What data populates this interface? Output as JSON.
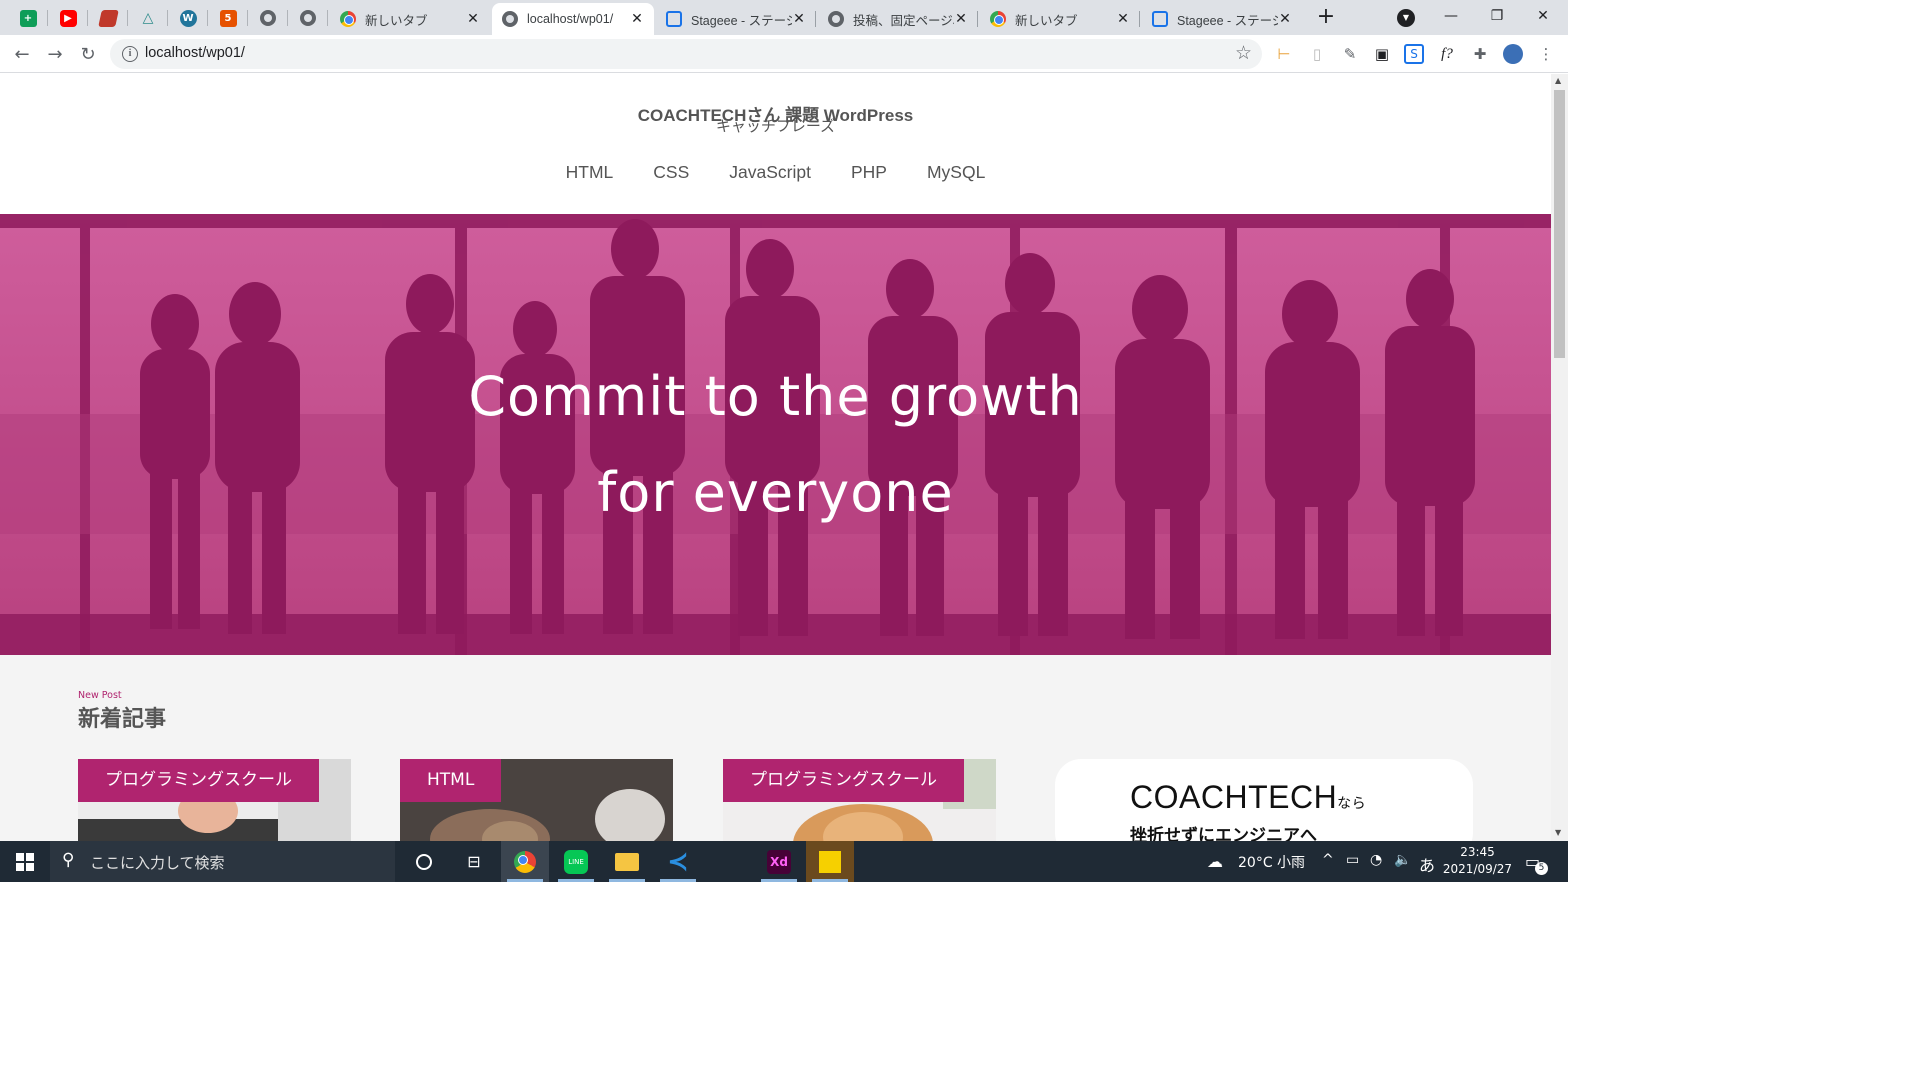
{
  "browser": {
    "tabs": [
      {
        "title": "新しいタブ",
        "active": false
      },
      {
        "title": "localhost/wp01/",
        "active": true
      },
      {
        "title": "Stageee - ステージー",
        "active": false
      },
      {
        "title": "投稿、固定ページ、カ",
        "active": false
      },
      {
        "title": "新しいタブ",
        "active": false
      },
      {
        "title": "Stageee - ステージー",
        "active": false
      }
    ],
    "new_tab_symbol": "+",
    "close_symbol": "✕",
    "address_bar": {
      "url": "localhost/wp01/"
    }
  },
  "site": {
    "title": "COACHTECHさん 課題 WordPress",
    "tagline": "キャッチフレーズ",
    "nav": [
      "HTML",
      "CSS",
      "JavaScript",
      "PHP",
      "MySQL"
    ],
    "hero": {
      "line1": "Commit to the growth",
      "line2": "for everyone"
    },
    "section": {
      "subtitle": "New Post",
      "title": "新着記事"
    },
    "cards": [
      {
        "category": "プログラミングスクール"
      },
      {
        "category": "HTML"
      },
      {
        "category": "プログラミングスクール"
      }
    ],
    "banner": {
      "logo": "COACHTECH",
      "suffix": "なら",
      "subtitle": "挫折せずにエンジニアへ"
    }
  },
  "taskbar": {
    "search_placeholder": "ここに入力して検索",
    "weather": "20°C 小雨",
    "ime": "あ",
    "time": "23:45",
    "date": "2021/09/27",
    "notifications": "5"
  },
  "colors": {
    "accent": "#b0246f",
    "hero_tint": "#c14b8d",
    "silhouette": "#8e1a5c"
  }
}
